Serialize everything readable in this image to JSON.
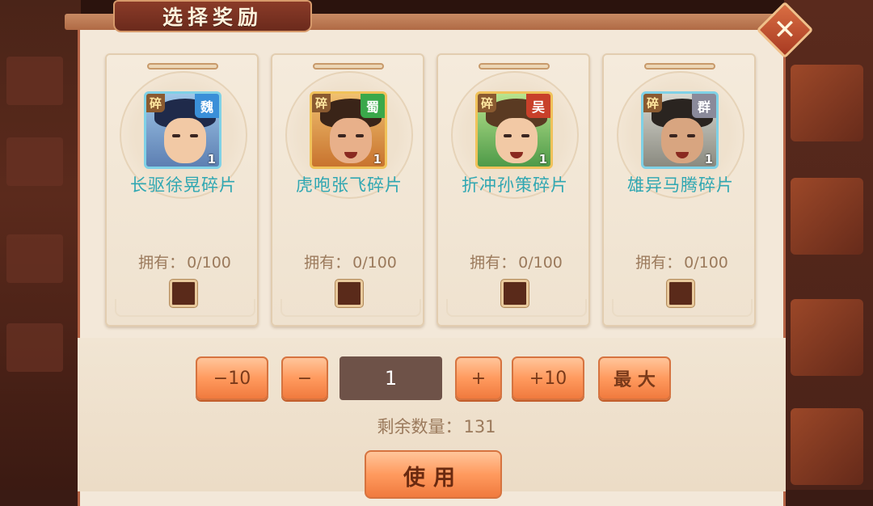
{
  "dialog": {
    "title": "选择奖励",
    "close_symbol": "✕"
  },
  "cards": [
    {
      "name": "长驱徐晃碎片",
      "fragment_tag": "碎",
      "faction": "魏",
      "faction_color": "#3a8fd8",
      "count_badge": "1",
      "owned_label": "拥有：",
      "owned_value": "0/100",
      "checked": false,
      "hair_color": "#1f2a4a"
    },
    {
      "name": "虎咆张飞碎片",
      "fragment_tag": "碎",
      "faction": "蜀",
      "faction_color": "#3aa84a",
      "count_badge": "1",
      "owned_label": "拥有：",
      "owned_value": "0/100",
      "checked": false,
      "hair_color": "#3a2418"
    },
    {
      "name": "折冲孙策碎片",
      "fragment_tag": "碎",
      "faction": "吴",
      "faction_color": "#c8402a",
      "count_badge": "1",
      "owned_label": "拥有：",
      "owned_value": "0/100",
      "checked": false,
      "hair_color": "#5a3a22"
    },
    {
      "name": "雄异马腾碎片",
      "fragment_tag": "碎",
      "faction": "群",
      "faction_color": "#8a8a9a",
      "count_badge": "1",
      "owned_label": "拥有：",
      "owned_value": "0/100",
      "checked": false,
      "hair_color": "#2a2420"
    }
  ],
  "controls": {
    "minus10": "−10",
    "minus1": "−",
    "quantity": "1",
    "plus1": "+",
    "plus10": "+10",
    "max": "最 大"
  },
  "remaining": {
    "label": "剩余数量：",
    "value": "131"
  },
  "use_button": "使用"
}
